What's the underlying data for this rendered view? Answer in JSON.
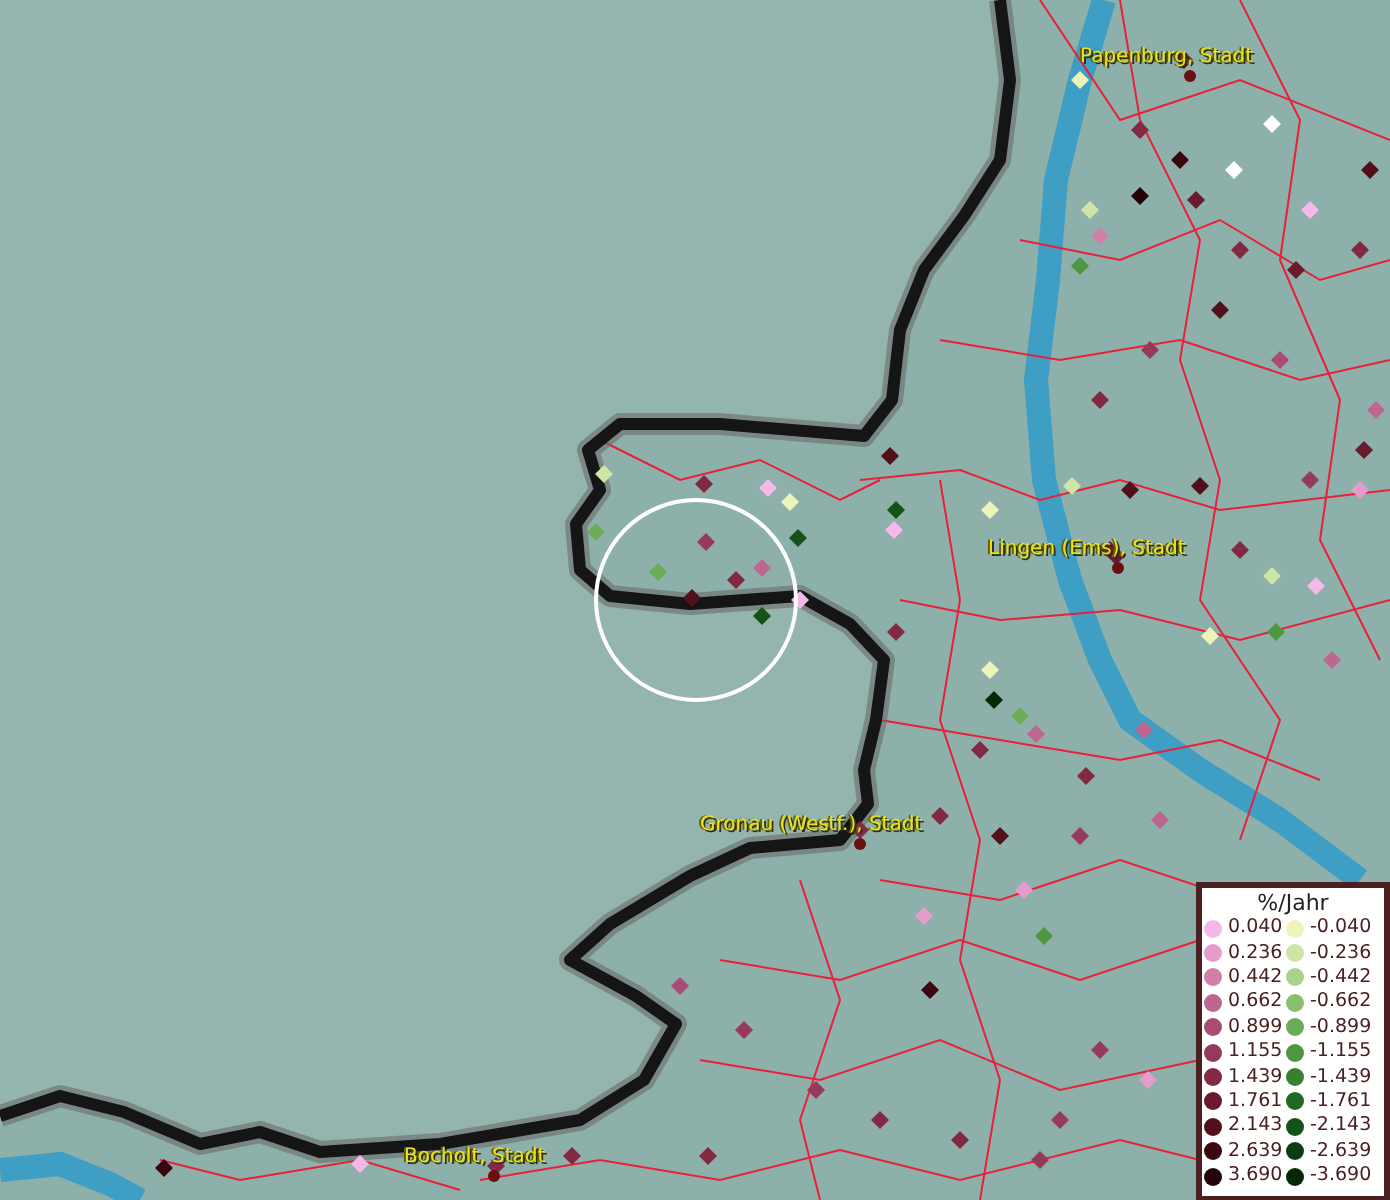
{
  "map": {
    "places": [
      {
        "name": "Papenburg, Stadt"
      },
      {
        "name": "Lingen (Ems), Stadt"
      },
      {
        "name": "Gronau (Westf.), Stadt"
      },
      {
        "name": "Bocholt, Stadt"
      }
    ]
  },
  "legend": {
    "title": "%/Jahr",
    "entries": [
      {
        "value": "0.040",
        "color": "#f4b8e6"
      },
      {
        "value": "-0.040",
        "color": "#eef4b8"
      },
      {
        "value": "0.236",
        "color": "#e49ccc"
      },
      {
        "value": "-0.236",
        "color": "#cde6a6"
      },
      {
        "value": "0.442",
        "color": "#d080a8"
      },
      {
        "value": "-0.442",
        "color": "#a8d48a"
      },
      {
        "value": "0.662",
        "color": "#bc6690"
      },
      {
        "value": "-0.662",
        "color": "#88c070"
      },
      {
        "value": "0.899",
        "color": "#a84c74"
      },
      {
        "value": "-0.899",
        "color": "#6aac58"
      },
      {
        "value": "1.155",
        "color": "#963a5c"
      },
      {
        "value": "-1.155",
        "color": "#4e9640"
      },
      {
        "value": "1.439",
        "color": "#822a44"
      },
      {
        "value": "-1.439",
        "color": "#368030"
      },
      {
        "value": "1.761",
        "color": "#6a1a2e"
      },
      {
        "value": "-1.761",
        "color": "#226822"
      },
      {
        "value": "2.143",
        "color": "#52101c"
      },
      {
        "value": "-2.143",
        "color": "#145218"
      },
      {
        "value": "2.639",
        "color": "#3a0810"
      },
      {
        "value": "-2.639",
        "color": "#0c3c10"
      },
      {
        "value": "3.690",
        "color": "#240408"
      },
      {
        "value": "-3.690",
        "color": "#062806"
      }
    ]
  }
}
